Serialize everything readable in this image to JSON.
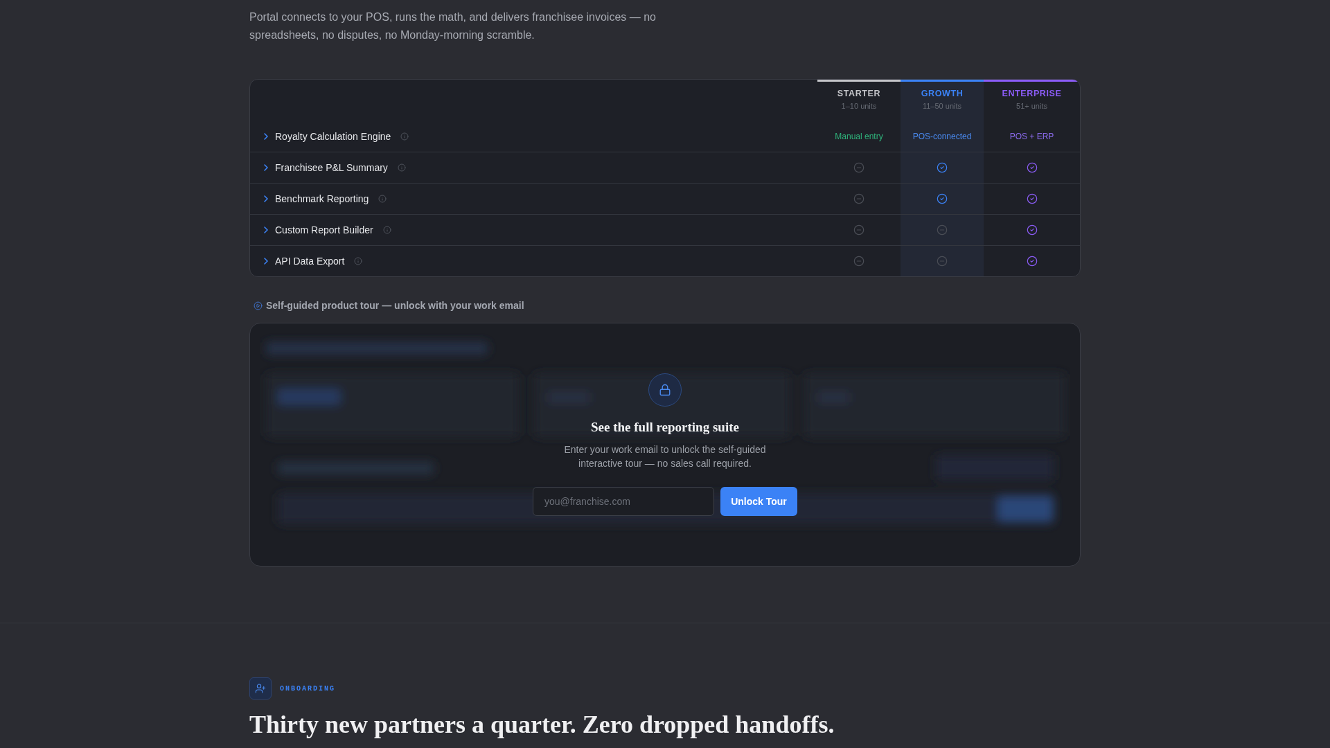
{
  "intro": {
    "text": "Portal connects to your POS, runs the math, and delivers franchisee invoices — no spreadsheets, no disputes, no Monday-morning scramble."
  },
  "comparison": {
    "tiers": [
      {
        "name": "STARTER",
        "units": "1–10 units",
        "color": "#c4c5c9",
        "highlighted": false
      },
      {
        "name": "GROWTH",
        "units": "11–50 units",
        "color": "#3b82f6",
        "highlighted": true
      },
      {
        "name": "ENTERPRISE",
        "units": "51+ units",
        "color": "#8b5cf6",
        "highlighted": false
      }
    ],
    "features": [
      {
        "name": "Royalty Calculation Engine",
        "expanded": false,
        "cells": [
          {
            "kind": "text",
            "text": "Manual entry",
            "color": "#2fb37b"
          },
          {
            "kind": "text",
            "text": "POS-connected",
            "color": "#4a8af0"
          },
          {
            "kind": "text",
            "text": "POS + ERP",
            "color": "#8d6cf0"
          }
        ]
      },
      {
        "name": "Franchisee P&L Summary",
        "expanded": false,
        "cells": [
          {
            "kind": "mark",
            "included": false
          },
          {
            "kind": "mark",
            "included": true
          },
          {
            "kind": "mark",
            "included": true
          }
        ]
      },
      {
        "name": "Benchmark Reporting",
        "expanded": false,
        "cells": [
          {
            "kind": "mark",
            "included": false
          },
          {
            "kind": "mark",
            "included": true
          },
          {
            "kind": "mark",
            "included": true
          }
        ]
      },
      {
        "name": "Custom Report Builder",
        "expanded": false,
        "cells": [
          {
            "kind": "mark",
            "included": false
          },
          {
            "kind": "mark",
            "included": false
          },
          {
            "kind": "mark",
            "included": true
          }
        ]
      },
      {
        "name": "API Data Export",
        "expanded": false,
        "cells": [
          {
            "kind": "mark",
            "included": false
          },
          {
            "kind": "mark",
            "included": false
          },
          {
            "kind": "mark",
            "included": true
          }
        ]
      }
    ]
  },
  "tour": {
    "label": "Self-guided product tour — unlock with your work email",
    "heading": "See the full reporting suite",
    "description": "Enter your work email to unlock the self-guided interactive tour — no sales call required.",
    "email": {
      "placeholder": "you@franchise.com"
    },
    "button": "Unlock Tour"
  },
  "onboarding": {
    "eyebrow": "ONBOARDING",
    "heading": "Thirty new partners a quarter. Zero dropped handoffs."
  }
}
